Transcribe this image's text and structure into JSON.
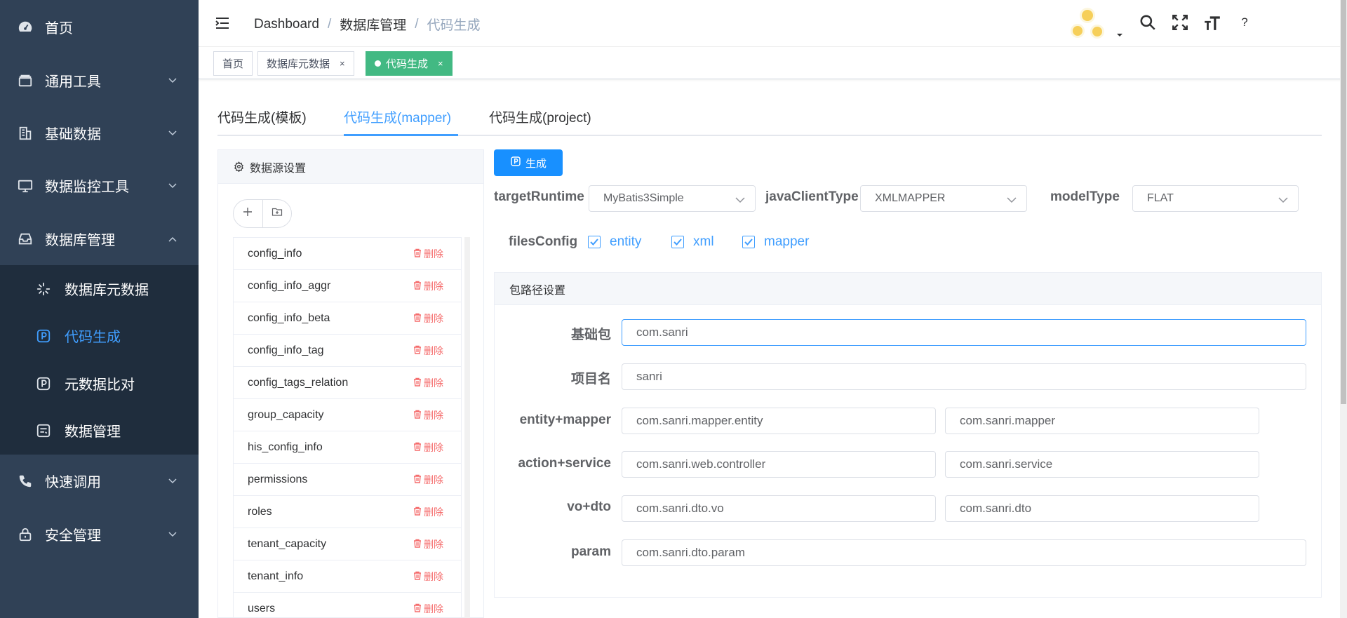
{
  "sidebar": {
    "items": [
      {
        "label": "首页",
        "icon": "dashboard-icon"
      },
      {
        "label": "通用工具",
        "icon": "toolbox-icon"
      },
      {
        "label": "基础数据",
        "icon": "building-icon"
      },
      {
        "label": "数据监控工具",
        "icon": "monitor-icon"
      },
      {
        "label": "数据库管理",
        "icon": "database-icon"
      },
      {
        "label": "快速调用",
        "icon": "phone-icon"
      },
      {
        "label": "安全管理",
        "icon": "lock-icon"
      }
    ],
    "sub_items": [
      {
        "label": "数据库元数据",
        "icon": "loading-icon"
      },
      {
        "label": "代码生成",
        "icon": "code-icon",
        "active": true
      },
      {
        "label": "元数据比对",
        "icon": "compare-icon"
      },
      {
        "label": "数据管理",
        "icon": "data-manage-icon"
      }
    ]
  },
  "header": {
    "breadcrumb": [
      "Dashboard",
      "数据库管理",
      "代码生成"
    ],
    "help": "?"
  },
  "tags": [
    {
      "label": "首页"
    },
    {
      "label": "数据库元数据",
      "close": "×"
    },
    {
      "label": "代码生成",
      "close": "×",
      "active": true
    }
  ],
  "tabs": [
    "代码生成(模板)",
    "代码生成(mapper)",
    "代码生成(project)"
  ],
  "datasource": {
    "title": "数据源设置",
    "tables": [
      "config_info",
      "config_info_aggr",
      "config_info_beta",
      "config_info_tag",
      "config_tags_relation",
      "group_capacity",
      "his_config_info",
      "permissions",
      "roles",
      "tenant_capacity",
      "tenant_info",
      "users"
    ],
    "delete_label": "删除"
  },
  "generate_label": "生成",
  "options": {
    "targetRuntime": {
      "label": "targetRuntime",
      "value": "MyBatis3Simple"
    },
    "javaClientType": {
      "label": "javaClientType",
      "value": "XMLMAPPER"
    },
    "modelType": {
      "label": "modelType",
      "value": "FLAT"
    }
  },
  "files_config": {
    "label": "filesConfig",
    "items": [
      {
        "label": "entity",
        "checked": true
      },
      {
        "label": "xml",
        "checked": true
      },
      {
        "label": "mapper",
        "checked": true
      }
    ]
  },
  "package": {
    "title": "包路径设置",
    "base": {
      "label": "基础包",
      "value": "com.sanri"
    },
    "project": {
      "label": "项目名",
      "value": "sanri"
    },
    "entity_mapper": {
      "label": "entity+mapper",
      "values": [
        "com.sanri.mapper.entity",
        "com.sanri.mapper"
      ]
    },
    "action_service": {
      "label": "action+service",
      "values": [
        "com.sanri.web.controller",
        "com.sanri.service"
      ]
    },
    "vo_dto": {
      "label": "vo+dto",
      "values": [
        "com.sanri.dto.vo",
        "com.sanri.dto"
      ]
    },
    "param": {
      "label": "param",
      "value": "com.sanri.dto.param"
    }
  },
  "colors": {
    "sidebar_bg": "#304156",
    "submenu_bg": "#1f2d3d",
    "accent": "#409eff",
    "tag_active": "#42b983",
    "danger": "#f56c6c",
    "primary_button": "#1890ff"
  }
}
